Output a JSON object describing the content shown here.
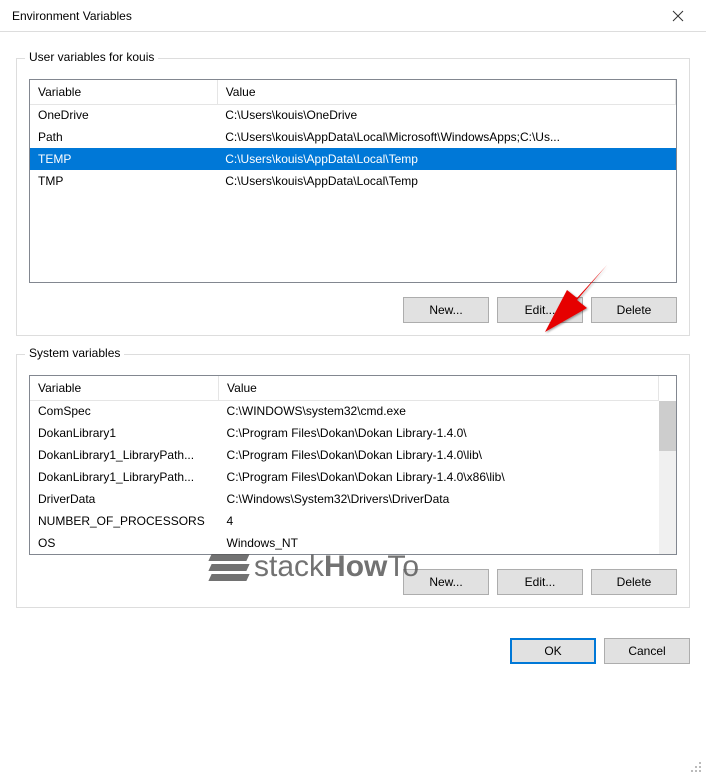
{
  "window": {
    "title": "Environment Variables"
  },
  "userGroup": {
    "label": "User variables for kouis",
    "cols": {
      "variable": "Variable",
      "value": "Value"
    },
    "rows": [
      {
        "variable": "OneDrive",
        "value": "C:\\Users\\kouis\\OneDrive",
        "selected": false
      },
      {
        "variable": "Path",
        "value": "C:\\Users\\kouis\\AppData\\Local\\Microsoft\\WindowsApps;C:\\Us...",
        "selected": false
      },
      {
        "variable": "TEMP",
        "value": "C:\\Users\\kouis\\AppData\\Local\\Temp",
        "selected": true
      },
      {
        "variable": "TMP",
        "value": "C:\\Users\\kouis\\AppData\\Local\\Temp",
        "selected": false
      }
    ],
    "buttons": {
      "new": "New...",
      "edit": "Edit...",
      "delete": "Delete"
    }
  },
  "systemGroup": {
    "label": "System variables",
    "cols": {
      "variable": "Variable",
      "value": "Value"
    },
    "rows": [
      {
        "variable": "ComSpec",
        "value": "C:\\WINDOWS\\system32\\cmd.exe"
      },
      {
        "variable": "DokanLibrary1",
        "value": "C:\\Program Files\\Dokan\\Dokan Library-1.4.0\\"
      },
      {
        "variable": "DokanLibrary1_LibraryPath...",
        "value": "C:\\Program Files\\Dokan\\Dokan Library-1.4.0\\lib\\"
      },
      {
        "variable": "DokanLibrary1_LibraryPath...",
        "value": "C:\\Program Files\\Dokan\\Dokan Library-1.4.0\\x86\\lib\\"
      },
      {
        "variable": "DriverData",
        "value": "C:\\Windows\\System32\\Drivers\\DriverData"
      },
      {
        "variable": "NUMBER_OF_PROCESSORS",
        "value": "4"
      },
      {
        "variable": "OS",
        "value": "Windows_NT"
      }
    ],
    "buttons": {
      "new": "New...",
      "edit": "Edit...",
      "delete": "Delete"
    }
  },
  "footer": {
    "ok": "OK",
    "cancel": "Cancel"
  },
  "watermark": {
    "text1": "stack",
    "text2": "How",
    "text3": "To"
  }
}
